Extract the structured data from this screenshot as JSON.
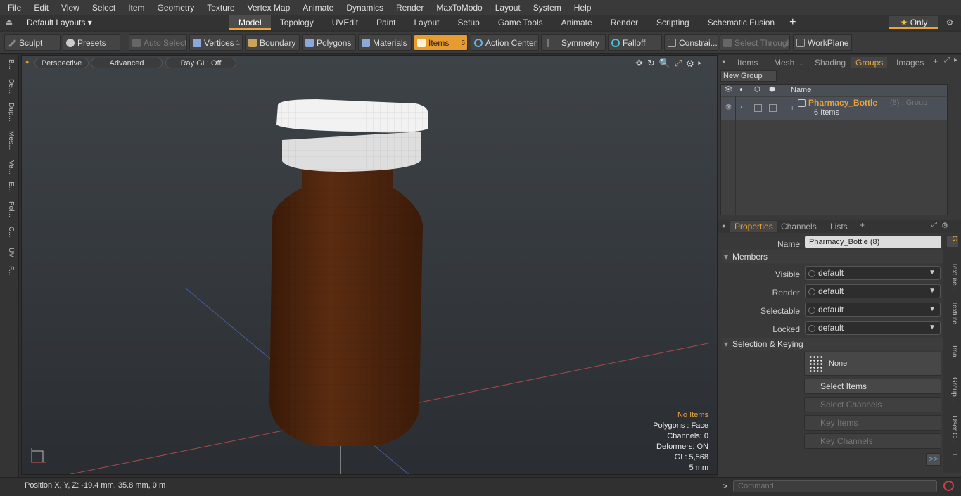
{
  "menu": [
    "File",
    "Edit",
    "View",
    "Select",
    "Item",
    "Geometry",
    "Texture",
    "Vertex Map",
    "Animate",
    "Dynamics",
    "Render",
    "MaxToModo",
    "Layout",
    "System",
    "Help"
  ],
  "layout": {
    "selector": "Default Layouts ▾",
    "tabs": [
      "Model",
      "Topology",
      "UVEdit",
      "Paint",
      "Layout",
      "Setup",
      "Game Tools",
      "Animate",
      "Render",
      "Scripting",
      "Schematic Fusion"
    ],
    "active": "Model",
    "only": "Only"
  },
  "toolbar": {
    "sculpt": "Sculpt",
    "presets": "Presets",
    "auto_select": "Auto Select",
    "vertices": "Vertices",
    "vertices_count": "1",
    "boundary": "Boundary",
    "polygons": "Polygons",
    "materials": "Materials",
    "items": "Items",
    "items_count": "5",
    "action_center": "Action Center",
    "symmetry": "Symmetry",
    "falloff": "Falloff",
    "constraints": "Constrai...",
    "select_through": "Select Through",
    "workplane": "WorkPlane"
  },
  "left_tabs": [
    "B...",
    "De...",
    "Dup...",
    "Mes...",
    "Ve...",
    "E...",
    "Pol...",
    "C...",
    "UV",
    "F..."
  ],
  "viewport": {
    "perspective": "Perspective",
    "advanced": "Advanced",
    "raygl": "Ray GL: Off",
    "info": {
      "no_items": "No Items",
      "polygons": "Polygons : Face",
      "channels": "Channels: 0",
      "deformers": "Deformers: ON",
      "gl": "GL: 5,568",
      "units": "5 mm"
    }
  },
  "status": {
    "position": "Position X, Y, Z:  -19.4 mm, 35.8 mm, 0 m"
  },
  "right": {
    "tabs": [
      "Items",
      "Mesh ...",
      "Shading",
      "Groups",
      "Images"
    ],
    "active_tab": "Groups",
    "new_group": "New Group",
    "list_header": "Name",
    "group": {
      "name": "Pharmacy_Bottle",
      "suffix": "(8) : Group",
      "count": "6 Items"
    },
    "prop_tabs": [
      "Properties",
      "Channels",
      "Lists"
    ],
    "name_label": "Name",
    "name_value": "Pharmacy_Bottle (8)",
    "members_label": "Members",
    "props": [
      {
        "label": "Visible",
        "value": "default"
      },
      {
        "label": "Render",
        "value": "default"
      },
      {
        "label": "Selectable",
        "value": "default"
      },
      {
        "label": "Locked",
        "value": "default"
      }
    ],
    "selection_label": "Selection & Keying",
    "none": "None",
    "select_items": "Select Items",
    "select_channels": "Select Channels",
    "key_items": "Key Items",
    "key_channels": "Key Channels",
    "more": ">>",
    "side_tabs": [
      "G...",
      "Texture...",
      "Texture ...",
      "Ima ...",
      "Group ...",
      "User C...",
      "T..."
    ],
    "command_placeholder": "Command"
  },
  "colors": {
    "accent": "#e8a33d",
    "bottle": "#4a230c",
    "cap": "#e4e4e4"
  }
}
